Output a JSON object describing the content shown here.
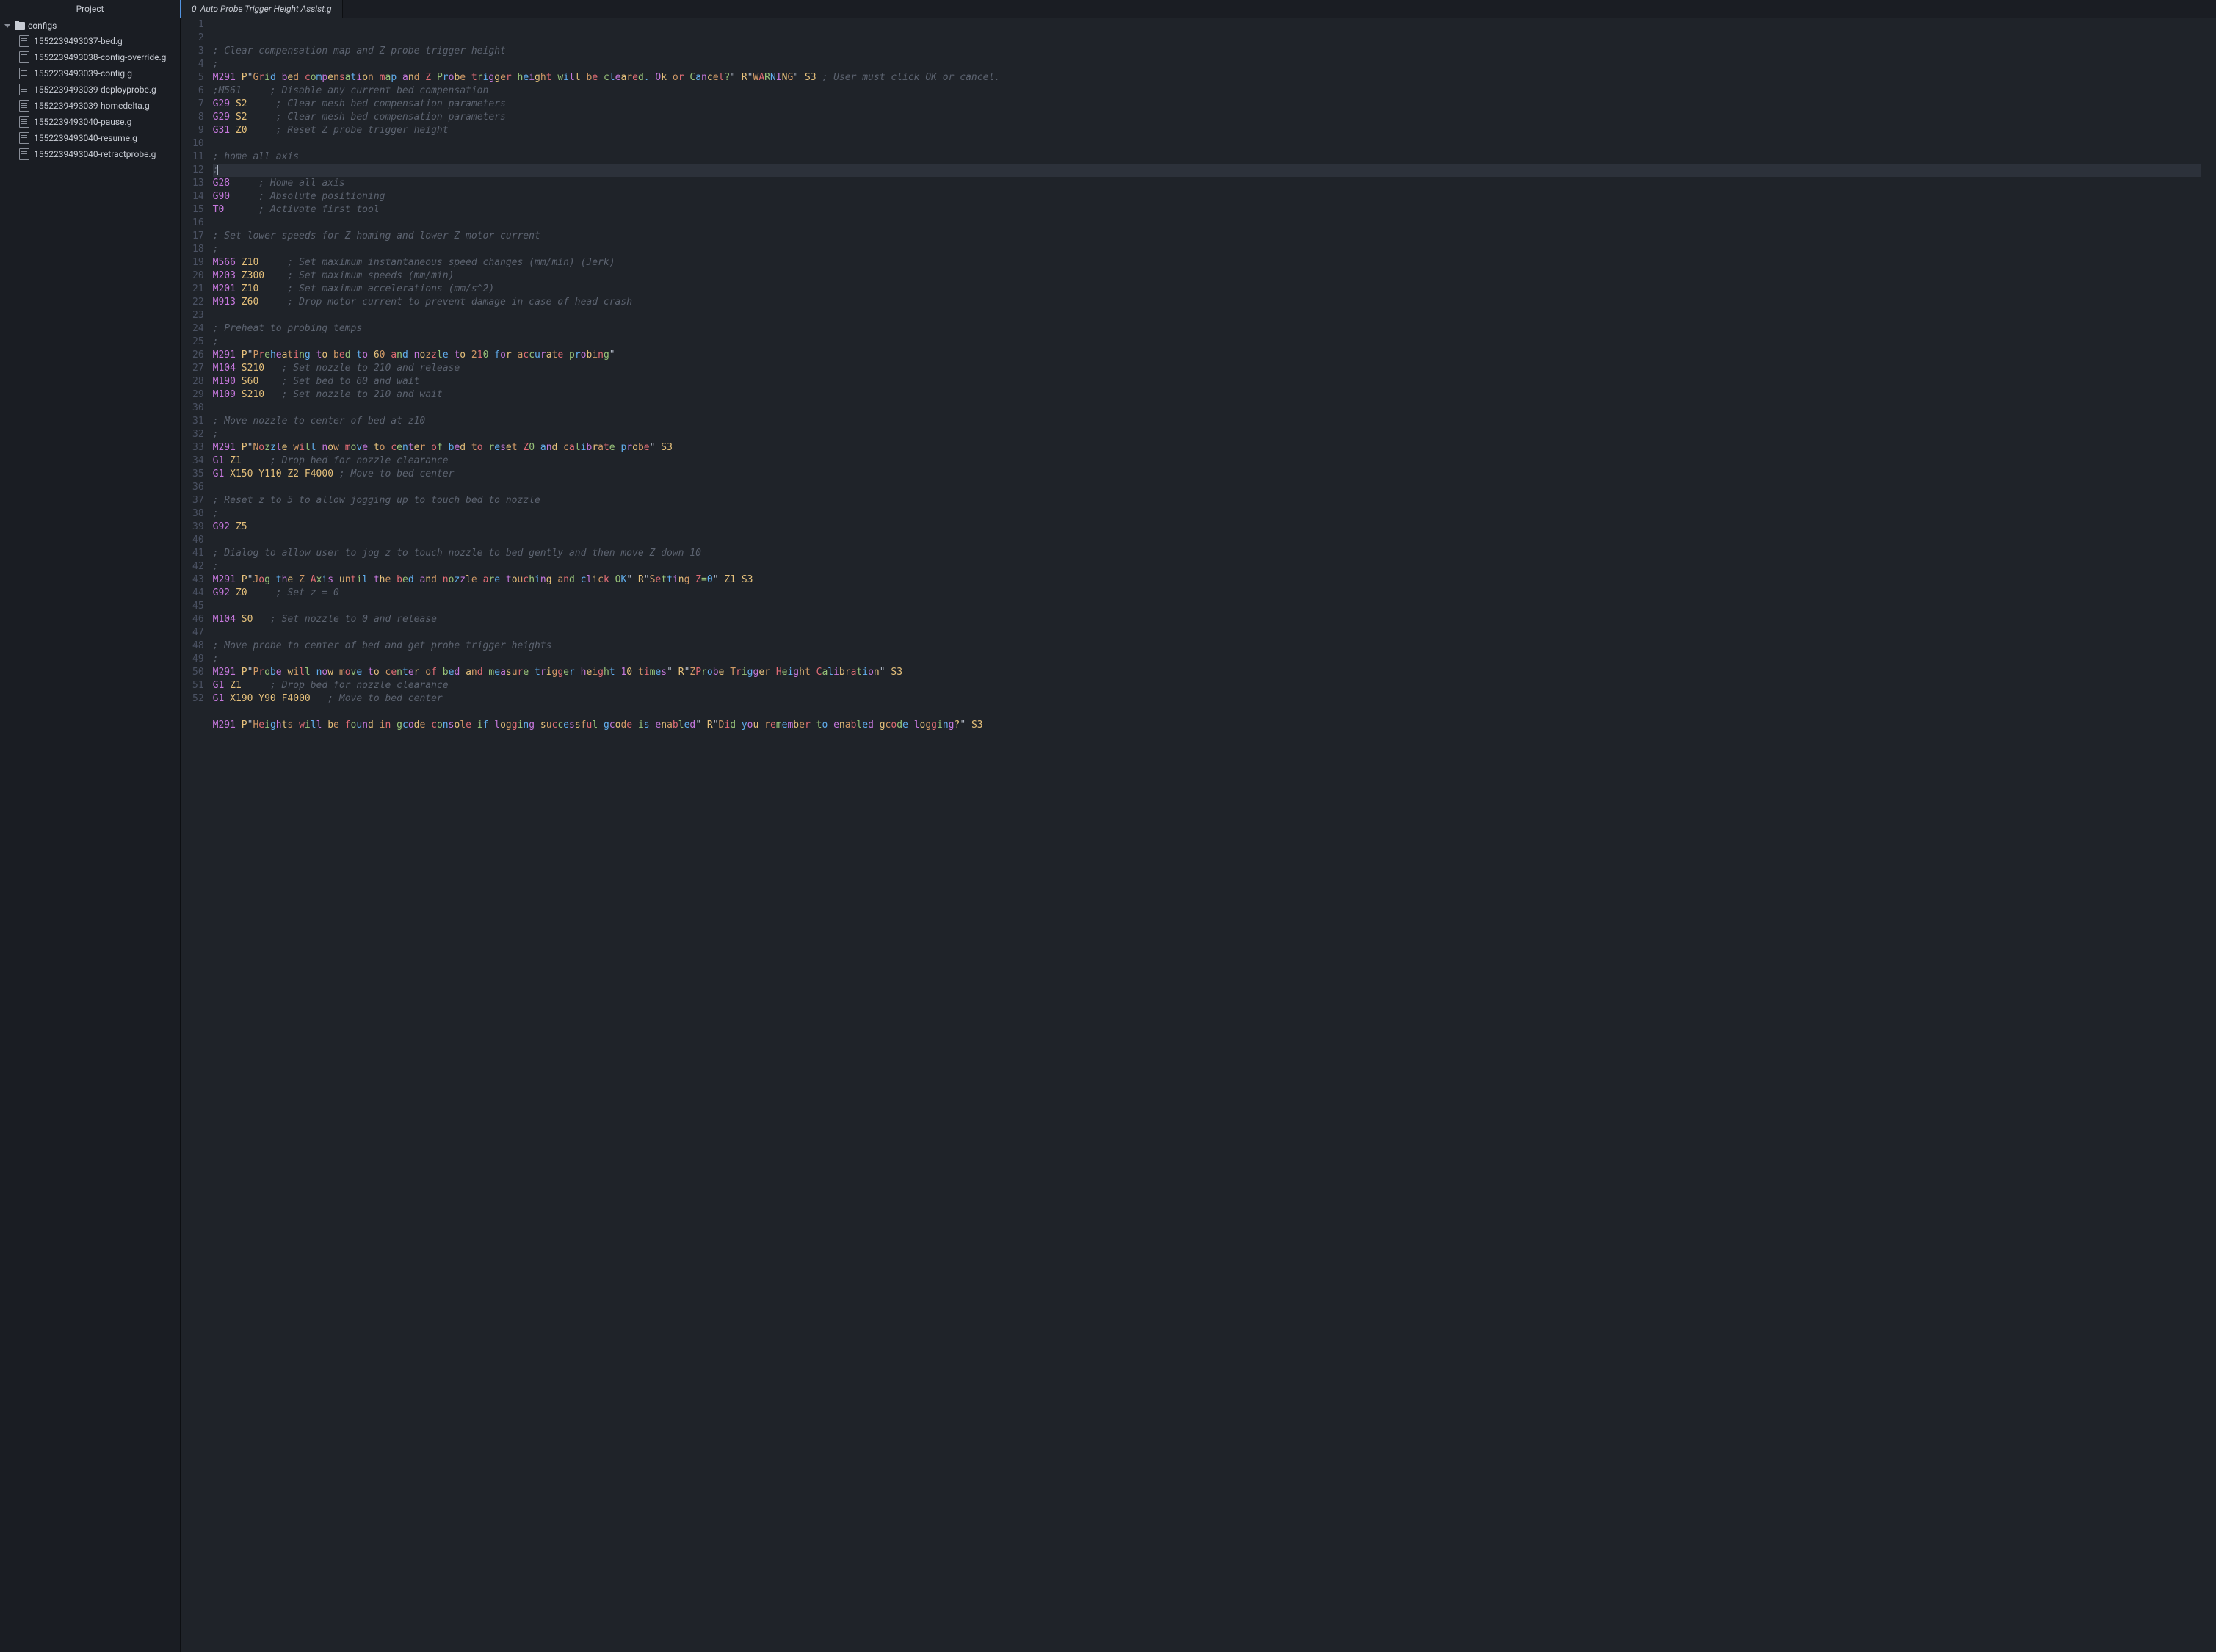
{
  "header": {
    "project_label": "Project",
    "tab_title": "0_Auto Probe Trigger Height Assist.g"
  },
  "sidebar": {
    "folder": "configs",
    "items": [
      "1552239493037-bed.g",
      "1552239493038-config-override.g",
      "1552239493039-config.g",
      "1552239493039-deployprobe.g",
      "1552239493039-homedelta.g",
      "1552239493040-pause.g",
      "1552239493040-resume.g",
      "1552239493040-retractprobe.g"
    ]
  },
  "editor": {
    "current_line": 10,
    "ruler_column": 80,
    "lines": [
      {
        "n": 1,
        "tokens": [
          [
            "comment",
            "; Clear compensation map and Z probe trigger height"
          ]
        ]
      },
      {
        "n": 2,
        "tokens": [
          [
            "comment",
            ";"
          ]
        ]
      },
      {
        "n": 3,
        "tokens": [
          [
            "cmd",
            "M291"
          ],
          [
            "sp",
            " "
          ],
          [
            "param",
            "P"
          ],
          [
            "str",
            "\"Grid bed compensation map and Z Probe trigger height will be cleared. Ok or Cancel?\""
          ],
          [
            "sp",
            " "
          ],
          [
            "param",
            "R"
          ],
          [
            "str",
            "\"WARNING\""
          ],
          [
            "sp",
            " "
          ],
          [
            "param",
            "S3"
          ],
          [
            "sp",
            " "
          ],
          [
            "comment",
            "; User must click OK or cancel."
          ]
        ]
      },
      {
        "n": 4,
        "tokens": [
          [
            "comment",
            ";M561     ; Disable any current bed compensation"
          ]
        ]
      },
      {
        "n": 5,
        "tokens": [
          [
            "cmd",
            "G29"
          ],
          [
            "sp",
            " "
          ],
          [
            "param",
            "S2"
          ],
          [
            "sp",
            "     "
          ],
          [
            "comment",
            "; Clear mesh bed compensation parameters"
          ]
        ]
      },
      {
        "n": 6,
        "tokens": [
          [
            "cmd",
            "G29"
          ],
          [
            "sp",
            " "
          ],
          [
            "param",
            "S2"
          ],
          [
            "sp",
            "     "
          ],
          [
            "comment",
            "; Clear mesh bed compensation parameters"
          ]
        ]
      },
      {
        "n": 7,
        "tokens": [
          [
            "cmd",
            "G31"
          ],
          [
            "sp",
            " "
          ],
          [
            "param",
            "Z0"
          ],
          [
            "sp",
            "     "
          ],
          [
            "comment",
            "; Reset Z probe trigger height"
          ]
        ]
      },
      {
        "n": 8,
        "tokens": []
      },
      {
        "n": 9,
        "tokens": [
          [
            "comment",
            "; home all axis"
          ]
        ]
      },
      {
        "n": 10,
        "tokens": [
          [
            "comment",
            ";"
          ],
          [
            "cursor",
            ""
          ]
        ]
      },
      {
        "n": 11,
        "tokens": [
          [
            "cmd",
            "G28"
          ],
          [
            "sp",
            "     "
          ],
          [
            "comment",
            "; Home all axis"
          ]
        ]
      },
      {
        "n": 12,
        "tokens": [
          [
            "cmd",
            "G90"
          ],
          [
            "sp",
            "     "
          ],
          [
            "comment",
            "; Absolute positioning"
          ]
        ]
      },
      {
        "n": 13,
        "tokens": [
          [
            "cmd",
            "T0"
          ],
          [
            "sp",
            "      "
          ],
          [
            "comment",
            "; Activate first tool"
          ]
        ]
      },
      {
        "n": 14,
        "tokens": []
      },
      {
        "n": 15,
        "tokens": [
          [
            "comment",
            "; Set lower speeds for Z homing and lower Z motor current"
          ]
        ]
      },
      {
        "n": 16,
        "tokens": [
          [
            "comment",
            ";"
          ]
        ]
      },
      {
        "n": 17,
        "tokens": [
          [
            "cmd",
            "M566"
          ],
          [
            "sp",
            " "
          ],
          [
            "param",
            "Z10"
          ],
          [
            "sp",
            "     "
          ],
          [
            "comment",
            "; Set maximum instantaneous speed changes (mm/min) (Jerk)"
          ]
        ]
      },
      {
        "n": 18,
        "tokens": [
          [
            "cmd",
            "M203"
          ],
          [
            "sp",
            " "
          ],
          [
            "param",
            "Z300"
          ],
          [
            "sp",
            "    "
          ],
          [
            "comment",
            "; Set maximum speeds (mm/min)"
          ]
        ]
      },
      {
        "n": 19,
        "tokens": [
          [
            "cmd",
            "M201"
          ],
          [
            "sp",
            " "
          ],
          [
            "param",
            "Z10"
          ],
          [
            "sp",
            "     "
          ],
          [
            "comment",
            "; Set maximum accelerations (mm/s^2)"
          ]
        ]
      },
      {
        "n": 20,
        "tokens": [
          [
            "cmd",
            "M913"
          ],
          [
            "sp",
            " "
          ],
          [
            "param",
            "Z60"
          ],
          [
            "sp",
            "     "
          ],
          [
            "comment",
            "; Drop motor current to prevent damage in case of head crash"
          ]
        ]
      },
      {
        "n": 21,
        "tokens": []
      },
      {
        "n": 22,
        "tokens": [
          [
            "comment",
            "; Preheat to probing temps"
          ]
        ]
      },
      {
        "n": 23,
        "tokens": [
          [
            "comment",
            ";"
          ]
        ]
      },
      {
        "n": 24,
        "tokens": [
          [
            "cmd",
            "M291"
          ],
          [
            "sp",
            " "
          ],
          [
            "param",
            "P"
          ],
          [
            "str",
            "\"Preheating to bed to 60 and nozzle to 210 for accurate probing\""
          ]
        ]
      },
      {
        "n": 25,
        "tokens": [
          [
            "cmd",
            "M104"
          ],
          [
            "sp",
            " "
          ],
          [
            "param",
            "S210"
          ],
          [
            "sp",
            "   "
          ],
          [
            "comment",
            "; Set nozzle to 210 and release"
          ]
        ]
      },
      {
        "n": 26,
        "tokens": [
          [
            "cmd",
            "M190"
          ],
          [
            "sp",
            " "
          ],
          [
            "param",
            "S60"
          ],
          [
            "sp",
            "    "
          ],
          [
            "comment",
            "; Set bed to 60 and wait"
          ]
        ]
      },
      {
        "n": 27,
        "tokens": [
          [
            "cmd",
            "M109"
          ],
          [
            "sp",
            " "
          ],
          [
            "param",
            "S210"
          ],
          [
            "sp",
            "   "
          ],
          [
            "comment",
            "; Set nozzle to 210 and wait"
          ]
        ]
      },
      {
        "n": 28,
        "tokens": []
      },
      {
        "n": 29,
        "tokens": [
          [
            "comment",
            "; Move nozzle to center of bed at z10"
          ]
        ]
      },
      {
        "n": 30,
        "tokens": [
          [
            "comment",
            ";"
          ]
        ]
      },
      {
        "n": 31,
        "tokens": [
          [
            "cmd",
            "M291"
          ],
          [
            "sp",
            " "
          ],
          [
            "param",
            "P"
          ],
          [
            "str",
            "\"Nozzle will now move to center of bed to reset Z0 and calibrate probe\""
          ],
          [
            "sp",
            " "
          ],
          [
            "param",
            "S3"
          ]
        ]
      },
      {
        "n": 32,
        "tokens": [
          [
            "cmd",
            "G1"
          ],
          [
            "sp",
            " "
          ],
          [
            "param",
            "Z1"
          ],
          [
            "sp",
            "     "
          ],
          [
            "comment",
            "; Drop bed for nozzle clearance"
          ]
        ]
      },
      {
        "n": 33,
        "tokens": [
          [
            "cmd",
            "G1"
          ],
          [
            "sp",
            " "
          ],
          [
            "param",
            "X150"
          ],
          [
            "sp",
            " "
          ],
          [
            "param",
            "Y110"
          ],
          [
            "sp",
            " "
          ],
          [
            "param",
            "Z2"
          ],
          [
            "sp",
            " "
          ],
          [
            "param",
            "F4000"
          ],
          [
            "sp",
            " "
          ],
          [
            "comment",
            "; Move to bed center"
          ]
        ]
      },
      {
        "n": 34,
        "tokens": []
      },
      {
        "n": 35,
        "tokens": [
          [
            "comment",
            "; Reset z to 5 to allow jogging up to touch bed to nozzle"
          ]
        ]
      },
      {
        "n": 36,
        "tokens": [
          [
            "comment",
            ";"
          ]
        ]
      },
      {
        "n": 37,
        "tokens": [
          [
            "cmd",
            "G92"
          ],
          [
            "sp",
            " "
          ],
          [
            "param",
            "Z5"
          ]
        ]
      },
      {
        "n": 38,
        "tokens": []
      },
      {
        "n": 39,
        "tokens": [
          [
            "comment",
            "; Dialog to allow user to jog z to touch nozzle to bed gently and then move Z down 10"
          ]
        ]
      },
      {
        "n": 40,
        "tokens": [
          [
            "comment",
            ";"
          ]
        ]
      },
      {
        "n": 41,
        "tokens": [
          [
            "cmd",
            "M291"
          ],
          [
            "sp",
            " "
          ],
          [
            "param",
            "P"
          ],
          [
            "str",
            "\"Jog the Z Axis until the bed and nozzle are touching and click OK\""
          ],
          [
            "sp",
            " "
          ],
          [
            "param",
            "R"
          ],
          [
            "str",
            "\"Setting Z=0\""
          ],
          [
            "sp",
            " "
          ],
          [
            "param",
            "Z1"
          ],
          [
            "sp",
            " "
          ],
          [
            "param",
            "S3"
          ]
        ]
      },
      {
        "n": 42,
        "tokens": [
          [
            "cmd",
            "G92"
          ],
          [
            "sp",
            " "
          ],
          [
            "param",
            "Z0"
          ],
          [
            "sp",
            "     "
          ],
          [
            "comment",
            "; Set z = 0"
          ]
        ]
      },
      {
        "n": 43,
        "tokens": []
      },
      {
        "n": 44,
        "tokens": [
          [
            "cmd",
            "M104"
          ],
          [
            "sp",
            " "
          ],
          [
            "param",
            "S0"
          ],
          [
            "sp",
            "   "
          ],
          [
            "comment",
            "; Set nozzle to 0 and release"
          ]
        ]
      },
      {
        "n": 45,
        "tokens": []
      },
      {
        "n": 46,
        "tokens": [
          [
            "comment",
            "; Move probe to center of bed and get probe trigger heights"
          ]
        ]
      },
      {
        "n": 47,
        "tokens": [
          [
            "comment",
            ";"
          ]
        ]
      },
      {
        "n": 48,
        "tokens": [
          [
            "cmd",
            "M291"
          ],
          [
            "sp",
            " "
          ],
          [
            "param",
            "P"
          ],
          [
            "str",
            "\"Probe will now move to center of bed and measure trigger height 10 times\""
          ],
          [
            "sp",
            " "
          ],
          [
            "param",
            "R"
          ],
          [
            "str",
            "\"ZProbe Trigger Height Calibration\""
          ],
          [
            "sp",
            " "
          ],
          [
            "param",
            "S3"
          ]
        ]
      },
      {
        "n": 49,
        "tokens": [
          [
            "cmd",
            "G1"
          ],
          [
            "sp",
            " "
          ],
          [
            "param",
            "Z1"
          ],
          [
            "sp",
            "     "
          ],
          [
            "comment",
            "; Drop bed for nozzle clearance"
          ]
        ]
      },
      {
        "n": 50,
        "tokens": [
          [
            "cmd",
            "G1"
          ],
          [
            "sp",
            " "
          ],
          [
            "param",
            "X190"
          ],
          [
            "sp",
            " "
          ],
          [
            "param",
            "Y90"
          ],
          [
            "sp",
            " "
          ],
          [
            "param",
            "F4000"
          ],
          [
            "sp",
            "   "
          ],
          [
            "comment",
            "; Move to bed center"
          ]
        ]
      },
      {
        "n": 51,
        "tokens": []
      },
      {
        "n": 52,
        "tokens": [
          [
            "cmd",
            "M291"
          ],
          [
            "sp",
            " "
          ],
          [
            "param",
            "P"
          ],
          [
            "str",
            "\"Heights will be found in gcode console if logging successful gcode is enabled\""
          ],
          [
            "sp",
            " "
          ],
          [
            "param",
            "R"
          ],
          [
            "str",
            "\"Did you remember to enabled gcode logging?\""
          ],
          [
            "sp",
            " "
          ],
          [
            "param",
            "S3"
          ]
        ]
      }
    ]
  }
}
